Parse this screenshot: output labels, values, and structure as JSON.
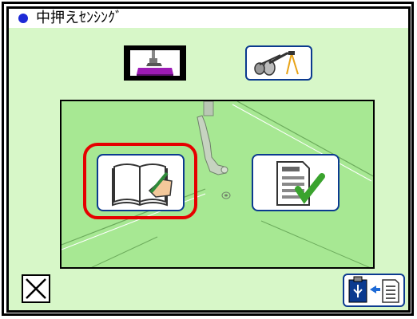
{
  "header": {
    "title": "中押えｾﾝｼﾝｸﾞ"
  },
  "icons": {
    "top_left": "presser-foot-icon",
    "top_right": "sensor-cable-icon",
    "book": "manual-book-icon",
    "check_document": "confirm-document-icon",
    "close": "close-icon",
    "usb": "usb-import-icon"
  },
  "colors": {
    "background": "#d7f7c8",
    "panel": "#a7e893",
    "highlight": "#e60000",
    "button_border": "#0b3a8f",
    "check": "#3aa32e"
  }
}
